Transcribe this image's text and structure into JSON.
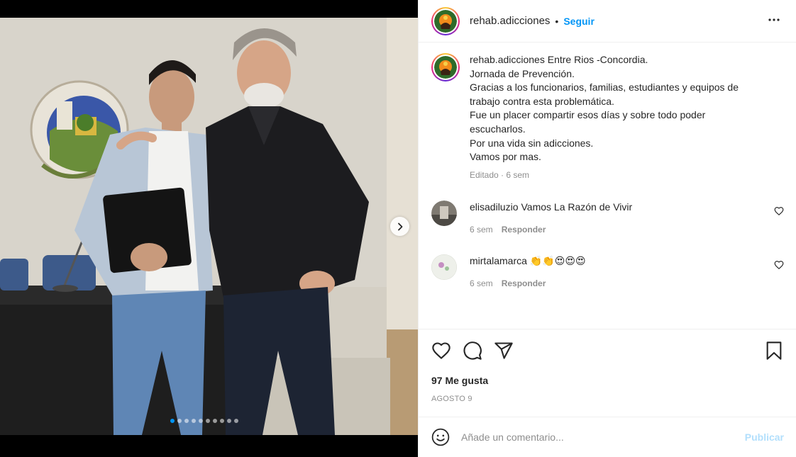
{
  "post": {
    "username": "rehab.adicciones",
    "follow_label": "Seguir",
    "separator": "•",
    "caption_lines": [
      "Entre Rios -Concordia.",
      "Jornada de Prevención.",
      "Gracias a los funcionarios, familias, estudiantes y equipos de",
      "trabajo contra esta problemática.",
      "Fue un placer compartir esos días y sobre todo poder",
      "escucharlos.",
      "Por una vida sin adicciones.",
      "Vamos por mas."
    ],
    "caption_meta": "Editado · 6 sem",
    "likes": "97 Me gusta",
    "date": "AGOSTO 9",
    "carousel": {
      "slides": 10,
      "current": 1
    }
  },
  "comments": [
    {
      "username": "elisadiluzio",
      "text": "Vamos La Razón de Vivir",
      "age": "6 sem",
      "reply_label": "Responder"
    },
    {
      "username": "mirtalamarca",
      "text": "👏👏😍😍😍",
      "age": "6 sem",
      "reply_label": "Responder"
    }
  ],
  "composer": {
    "placeholder": "Añade un comentario...",
    "post_label": "Publicar"
  },
  "icons": {
    "more": "more-horizontal-icon",
    "like": "heart-icon",
    "comment": "comment-icon",
    "share": "paper-plane-icon",
    "save": "bookmark-icon",
    "emoji": "emoji-icon",
    "next": "chevron-right-icon"
  },
  "colors": {
    "accent": "#0095f6",
    "text": "#262626",
    "muted": "#8e8e8e",
    "post_disabled": "#b2dffc"
  }
}
